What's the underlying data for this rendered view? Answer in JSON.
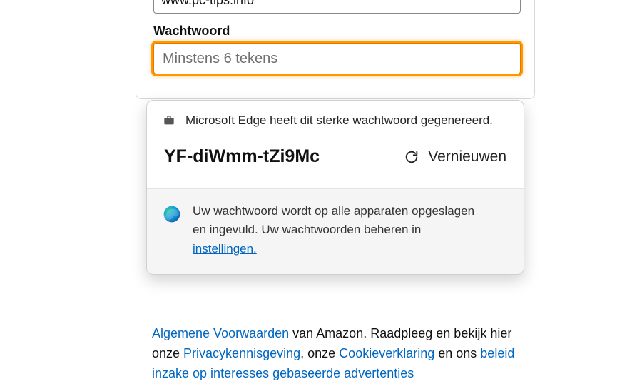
{
  "form": {
    "website_value": "www.pc-tips.info",
    "password_label": "Wachtwoord",
    "password_placeholder": "Minstens 6 tekens"
  },
  "popup": {
    "header_text": "Microsoft Edge heeft dit sterke wachtwoord gegenereerd.",
    "generated_password": "YF-diWmm-tZi9Mc",
    "refresh_label": "Vernieuwen",
    "footer_text_before": "Uw wachtwoord wordt op alle apparaten opgeslagen en ingevuld. Uw wachtwoorden beheren in ",
    "footer_link": "instellingen."
  },
  "terms": {
    "link1": "Algemene Voorwaarden",
    "text1": " van Amazon. Raadpleeg en bekijk hier onze ",
    "link2": "Privacykennisgeving",
    "text2": ", onze ",
    "link3": "Cookieverklaring",
    "text3": " en ons ",
    "link4": "beleid inzake op interesses gebaseerde advertenties"
  }
}
